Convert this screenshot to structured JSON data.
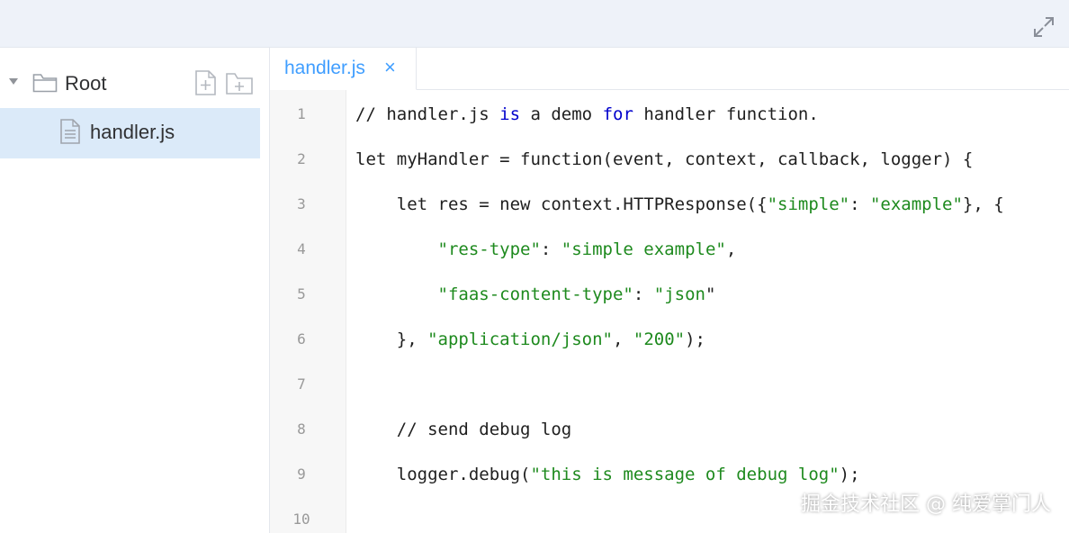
{
  "colors": {
    "accent": "#409eff",
    "selection_bg": "#dbeaf9",
    "string": "#1e8a1e",
    "keyword": "#0000cc"
  },
  "topbar": {
    "expand_icon": "expand-arrows-icon"
  },
  "file_tree": {
    "root_label": "Root",
    "new_file_icon": "new-file-icon",
    "new_folder_icon": "new-folder-icon",
    "files": [
      {
        "name": "handler.js",
        "icon": "file-icon",
        "selected": true
      }
    ]
  },
  "editor": {
    "tab": {
      "label": "handler.js",
      "close": "×"
    },
    "line_numbers": [
      "1",
      "2",
      "3",
      "4",
      "5",
      "6",
      "7",
      "8",
      "9",
      "10"
    ],
    "lines": [
      [
        {
          "t": "// handler.js "
        },
        {
          "t": "is",
          "k": "kw"
        },
        {
          "t": " a demo "
        },
        {
          "t": "for",
          "k": "kw"
        },
        {
          "t": " handler function."
        }
      ],
      [
        {
          "t": "let myHandler = function(event, context, callback, logger) {"
        }
      ],
      [
        {
          "t": "    let res = new context.HTTPResponse({"
        },
        {
          "t": "\"simple\"",
          "k": "str"
        },
        {
          "t": ": "
        },
        {
          "t": "\"example\"",
          "k": "str"
        },
        {
          "t": "}, {"
        }
      ],
      [
        {
          "t": "        "
        },
        {
          "t": "\"res-type\"",
          "k": "str"
        },
        {
          "t": ": "
        },
        {
          "t": "\"simple example\"",
          "k": "str"
        },
        {
          "t": ","
        }
      ],
      [
        {
          "t": "        "
        },
        {
          "t": "\"faas-content-type\"",
          "k": "str"
        },
        {
          "t": ": "
        },
        {
          "t": "\"json",
          "k": "str"
        },
        {
          "t": "\""
        }
      ],
      [
        {
          "t": "    }, "
        },
        {
          "t": "\"application/json\"",
          "k": "str"
        },
        {
          "t": ", "
        },
        {
          "t": "\"200\"",
          "k": "str"
        },
        {
          "t": ");"
        }
      ],
      [],
      [
        {
          "t": "    // send debug log"
        }
      ],
      [
        {
          "t": "    logger.debug("
        },
        {
          "t": "\"this is message of debug log\"",
          "k": "str"
        },
        {
          "t": ");"
        }
      ],
      []
    ]
  },
  "watermark": "掘金技术社区 @ 纯爱掌门人"
}
